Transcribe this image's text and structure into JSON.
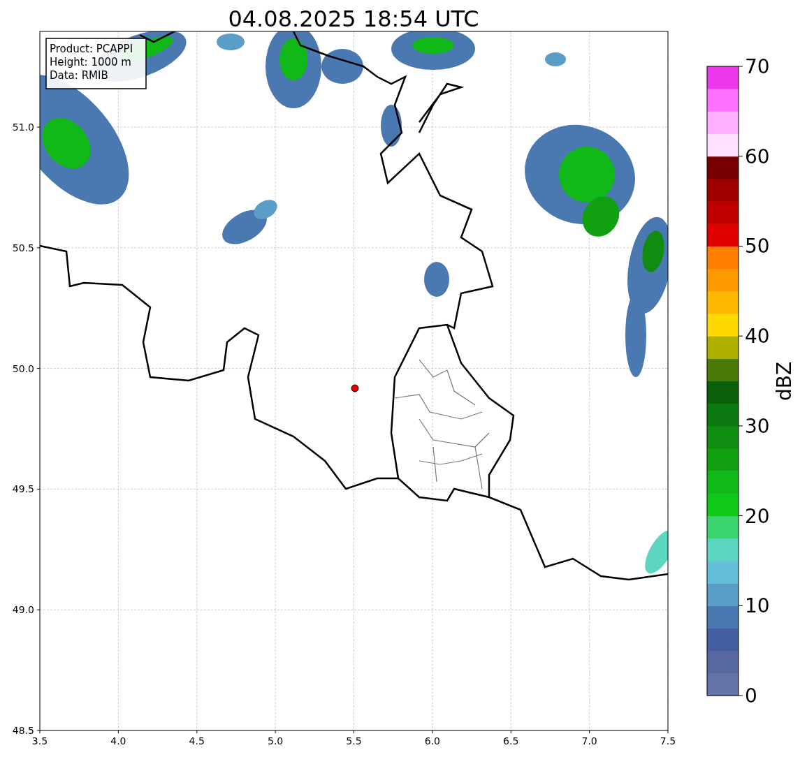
{
  "title": "04.08.2025 18:54 UTC",
  "info_box": {
    "lines": [
      "Product: PCAPPI",
      "Height: 1000 m",
      "Data: RMIB"
    ]
  },
  "map": {
    "x_ticks": [
      "3.5",
      "4.0",
      "4.5",
      "5.0",
      "5.5",
      "6.0",
      "6.5",
      "7.0",
      "7.5"
    ],
    "y_ticks": [
      "51.0",
      "50.5",
      "50.0",
      "49.5",
      "49.0",
      "48.5"
    ]
  },
  "colorbar": {
    "label": "dBZ",
    "ticks": [
      "70",
      "60",
      "50",
      "40",
      "30",
      "20",
      "10",
      "0"
    ],
    "bands": [
      {
        "color": "#6574a8"
      },
      {
        "color": "#5568a0"
      },
      {
        "color": "#4460a2"
      },
      {
        "color": "#4a78b0"
      },
      {
        "color": "#5a9ec8"
      },
      {
        "color": "#64c0d8"
      },
      {
        "color": "#5cd6c0"
      },
      {
        "color": "#3cd470"
      },
      {
        "color": "#10c818"
      },
      {
        "color": "#10b818"
      },
      {
        "color": "#10a010"
      },
      {
        "color": "#108c10"
      },
      {
        "color": "#0c7810"
      },
      {
        "color": "#0a600a"
      },
      {
        "color": "#4a7a08"
      },
      {
        "color": "#b0b000"
      },
      {
        "color": "#ffd800"
      },
      {
        "color": "#ffb800"
      },
      {
        "color": "#ff9a00"
      },
      {
        "color": "#ff7e00"
      },
      {
        "color": "#e00000"
      },
      {
        "color": "#c00000"
      },
      {
        "color": "#a00000"
      },
      {
        "color": "#780000"
      },
      {
        "color": "#ffe0ff"
      },
      {
        "color": "#ffb0ff"
      },
      {
        "color": "#ff70ff"
      },
      {
        "color": "#ee38ee"
      }
    ]
  }
}
